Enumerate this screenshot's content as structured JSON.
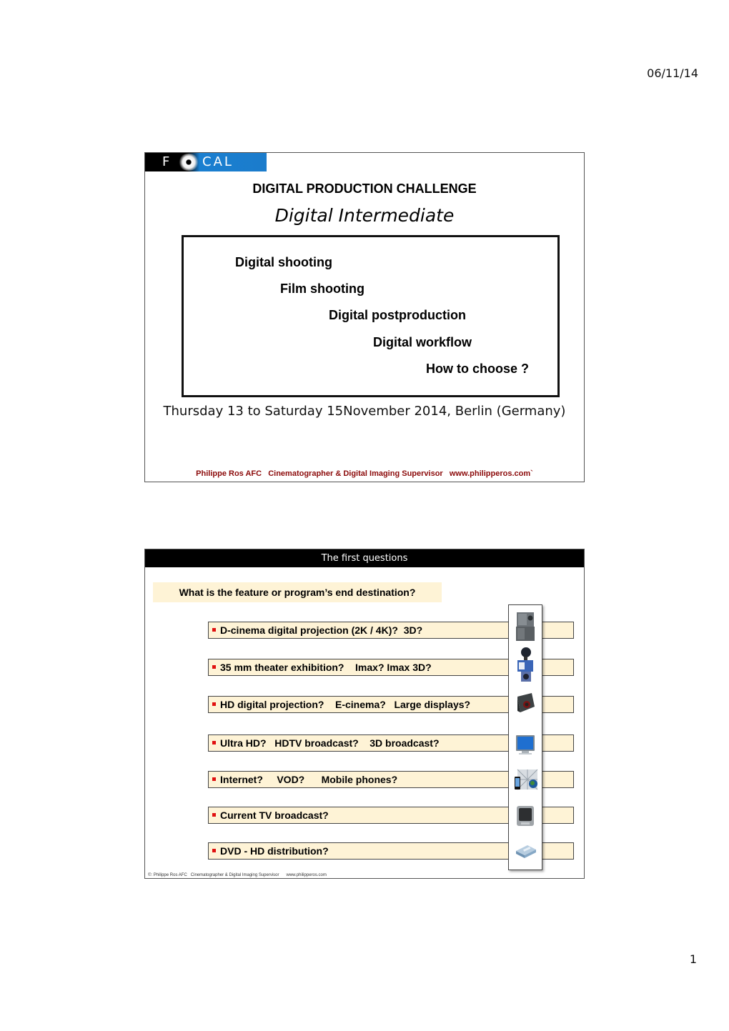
{
  "page": {
    "date": "06/11/14",
    "number": "1"
  },
  "slide1": {
    "logo": {
      "left": "F",
      "right": "CAL",
      "icon": "eye-lens-icon"
    },
    "title": "DIGITAL PRODUCTION CHALLENGE",
    "subtitle": "Digital Intermediate",
    "topics": [
      "Digital shooting",
      "Film shooting",
      "Digital postproduction",
      "Digital workflow",
      "How to choose ?"
    ],
    "event": "Thursday 13 to Saturday 15November 2014, Berlin (Germany)",
    "credit": "Philippe Ros AFC   Cinematographer & Digital Imaging Supervisor   www.philipperos.com`"
  },
  "slide2": {
    "header": "The first questions",
    "question": "What is the feature or program’s end destination?",
    "destinations": [
      {
        "text": "D-cinema digital projection (2K / 4K)?  3D?",
        "icon": "dcinema-projector-icon"
      },
      {
        "text": "35 mm theater exhibition?    Imax? Imax 3D?",
        "icon": "film-projector-icon"
      },
      {
        "text": "HD digital projection?    E-cinema?   Large displays?",
        "icon": "hd-projector-icon"
      },
      {
        "text": "Ultra HD?   HDTV broadcast?    3D broadcast?",
        "icon": "flatscreen-tv-icon"
      },
      {
        "text": "Internet?     VOD?      Mobile phones?",
        "icon": "internet-mobile-icon"
      },
      {
        "text": "Current TV broadcast?",
        "icon": "crt-tv-icon"
      },
      {
        "text": "DVD - HD distribution?",
        "icon": "dvd-player-icon"
      }
    ],
    "bullet_color": "#e01010",
    "credit": "©: Philippe Ros AFC   Cinematographer & Digital Imaging Supervisor      www.philipperos.com"
  }
}
